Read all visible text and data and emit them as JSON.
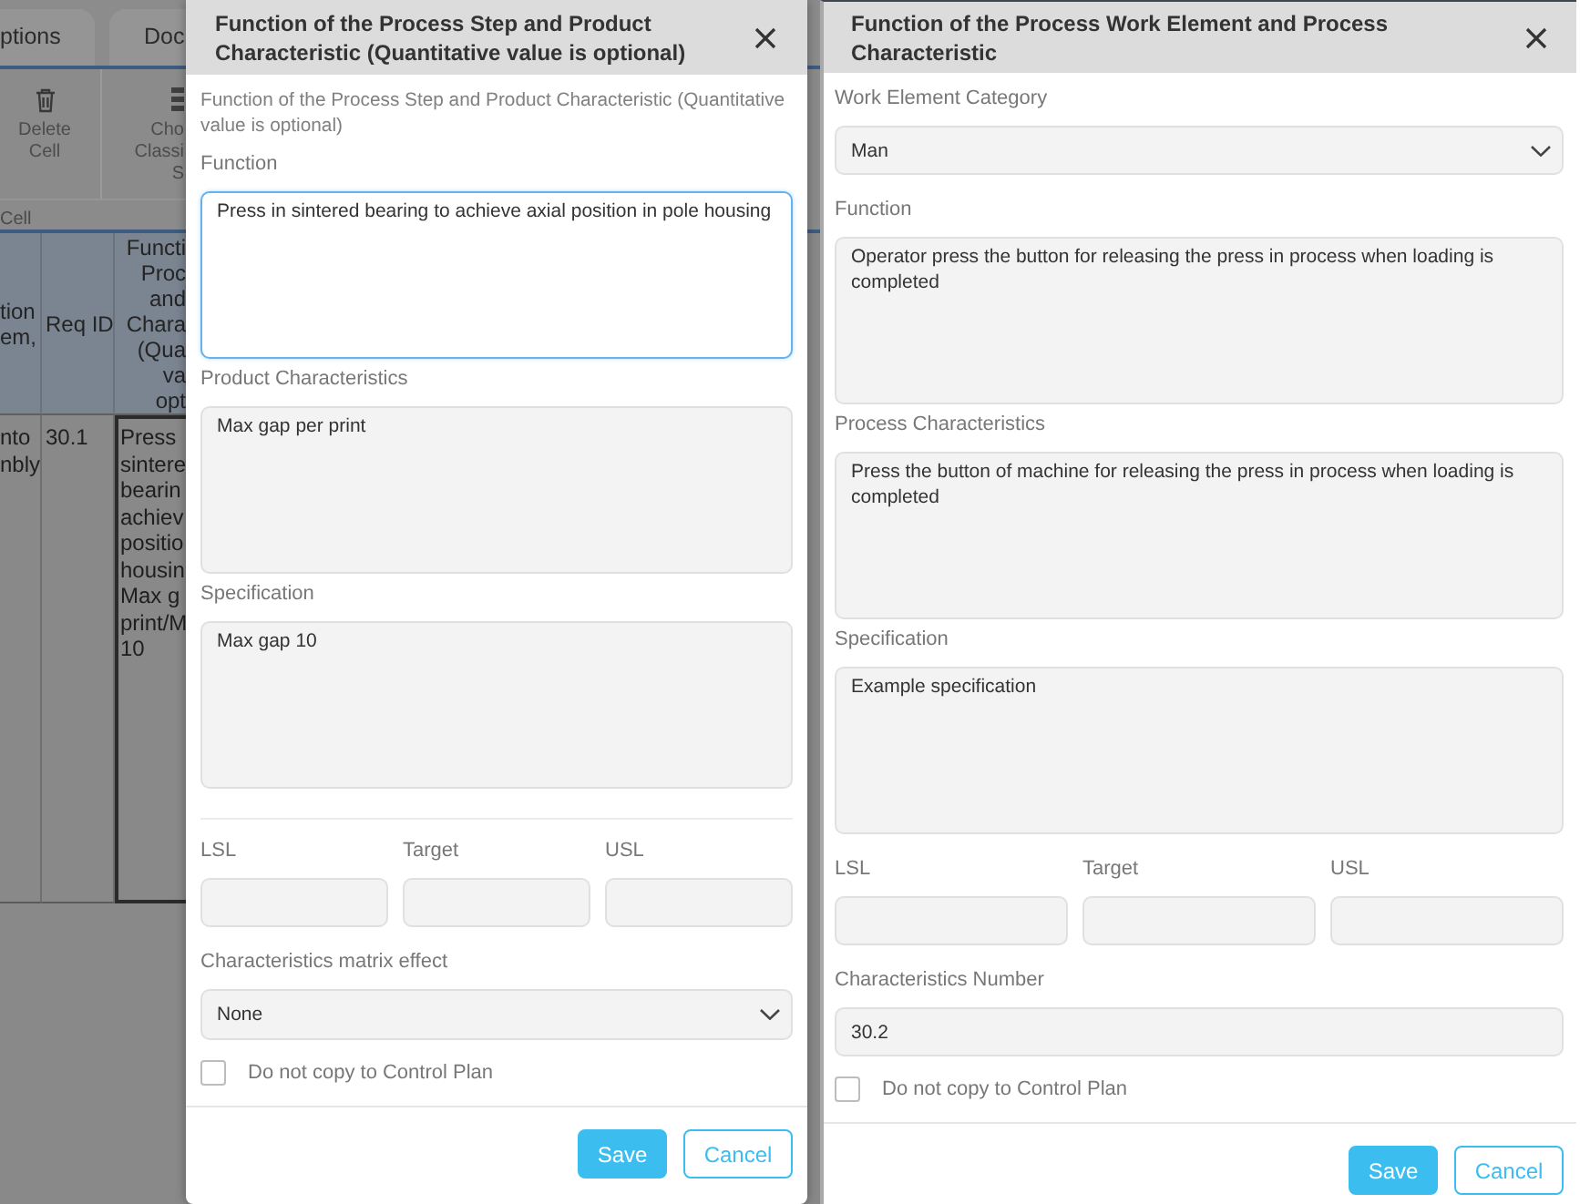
{
  "background_app": {
    "tabs": [
      {
        "label": "ptions"
      },
      {
        "label": "Doc"
      }
    ],
    "toolbar": {
      "buttons": [
        {
          "label": "Delete Cell"
        },
        {
          "label": "Cho\nClassi\nS"
        }
      ],
      "group_label": "Cell"
    },
    "table": {
      "columns": [
        "tion\nem,",
        "Req ID",
        "Functi\nProc\nand\nChara\n(Qua\nva\nopt"
      ],
      "rows": [
        {
          "cells": [
            {
              "text": "nto\nnbly",
              "selected": false
            },
            {
              "text": "30.1",
              "selected": false
            },
            {
              "text": "Press\nsintere\nbearin\nachiev\npositio\nhousin\nMax g\nprint/M\n10",
              "selected": true
            }
          ]
        }
      ]
    }
  },
  "dialogs": [
    {
      "title": "Function of the Process Step and Product Characteristic (Quantitative value is optional)",
      "subtitle": "Function of the Process Step and Product Characteristic (Quantitative value is optional)",
      "fields": [
        {
          "kind": "textarea",
          "label": "Function",
          "value": "Press in sintered bearing to achieve axial position in pole housing",
          "focused": true
        },
        {
          "kind": "textarea",
          "label": "Product Characteristics",
          "value": "Max gap per print",
          "focused": false
        },
        {
          "kind": "textarea",
          "label": "Specification",
          "value": "Max gap 10",
          "focused": false
        },
        {
          "kind": "divider"
        },
        {
          "kind": "limits",
          "items": [
            {
              "label": "LSL"
            },
            {
              "label": "Target"
            },
            {
              "label": "USL"
            }
          ]
        },
        {
          "kind": "select",
          "label": "Characteristics matrix effect",
          "value": "None",
          "focused": false
        }
      ],
      "checkbox": {
        "label": "Do not copy to Control Plan",
        "checked": false
      },
      "buttons": [
        {
          "label": "Save",
          "kind": "primary"
        },
        {
          "label": "Cancel",
          "kind": "secondary"
        }
      ]
    },
    {
      "title": "Function of the Process Work Element and Process Characteristic",
      "fields": [
        {
          "kind": "select",
          "label": "Work Element Category",
          "value": "Man",
          "focused": false
        },
        {
          "kind": "textarea",
          "label": "Function",
          "value": "Operator press the button for releasing the press in process when loading is completed",
          "focused": false
        },
        {
          "kind": "textarea",
          "label": "Process Characteristics",
          "value": "Press the button of machine for releasing the press in process when loading is completed",
          "focused": false
        },
        {
          "kind": "textarea",
          "label": "Specification",
          "value": "Example specification",
          "focused": false
        },
        {
          "kind": "limits",
          "items": [
            {
              "label": "LSL"
            },
            {
              "label": "Target"
            },
            {
              "label": "USL"
            }
          ]
        },
        {
          "kind": "input",
          "label": "Characteristics Number",
          "value": "30.2",
          "focused": false
        }
      ],
      "checkbox": {
        "label": "Do not copy to Control Plan",
        "checked": false
      },
      "buttons": [
        {
          "label": "Save",
          "kind": "primary"
        },
        {
          "label": "Cancel",
          "kind": "secondary"
        }
      ]
    }
  ]
}
